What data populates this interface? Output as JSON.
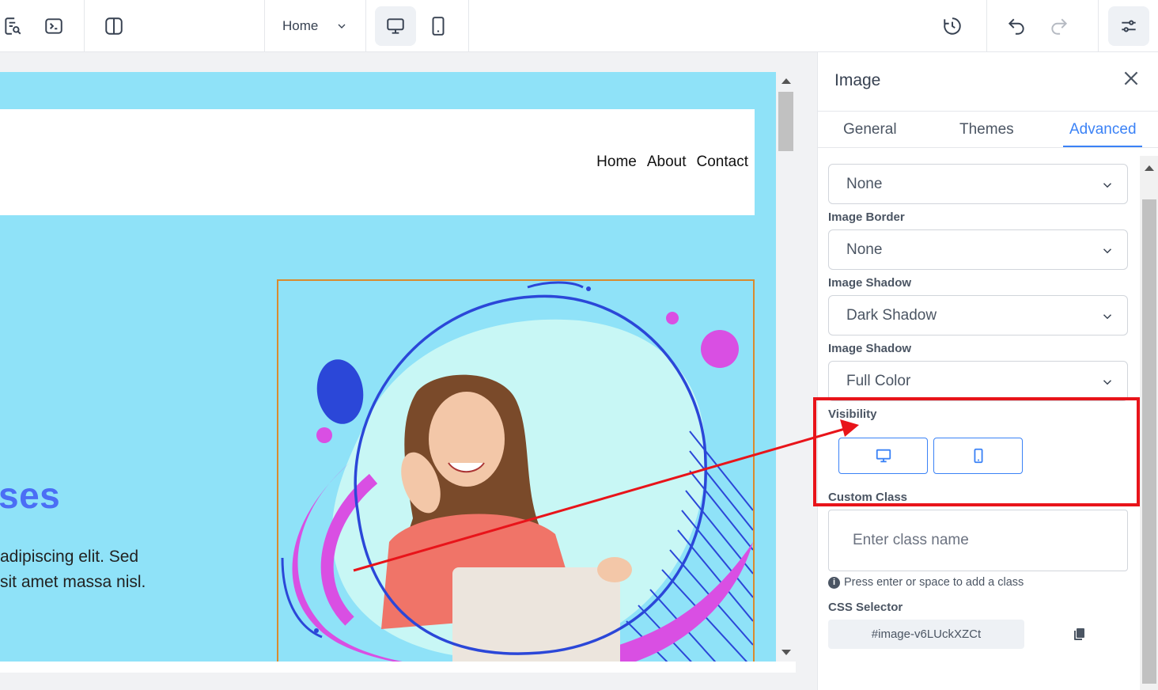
{
  "toolbar": {
    "page_select": "Home"
  },
  "site": {
    "nav_links": [
      "Home",
      "About",
      "Contact"
    ],
    "hero_title": "ses",
    "hero_text_line1": "adipiscing elit. Sed",
    "hero_text_line2": "sit amet massa nisl."
  },
  "panel": {
    "title": "Image",
    "tabs": [
      "General",
      "Themes",
      "Advanced"
    ],
    "active_tab": "Advanced",
    "select1_value": "None",
    "image_border_label": "Image Border",
    "image_border_value": "None",
    "image_shadow_label": "Image Shadow",
    "image_shadow_value": "Dark Shadow",
    "image_shadow2_label": "Image Shadow",
    "image_shadow2_value": "Full Color",
    "visibility_label": "Visibility",
    "custom_class_label": "Custom Class",
    "custom_class_placeholder": "Enter class name",
    "hint": "Press enter or space to add a class",
    "css_selector_label": "CSS Selector",
    "css_selector_value": "#image-v6LUckXZCt"
  },
  "colors": {
    "accent": "#3b82f6",
    "site_bg": "#8fe2f8",
    "hero_title": "#4b6ef5",
    "annotation": "#e8141a"
  }
}
